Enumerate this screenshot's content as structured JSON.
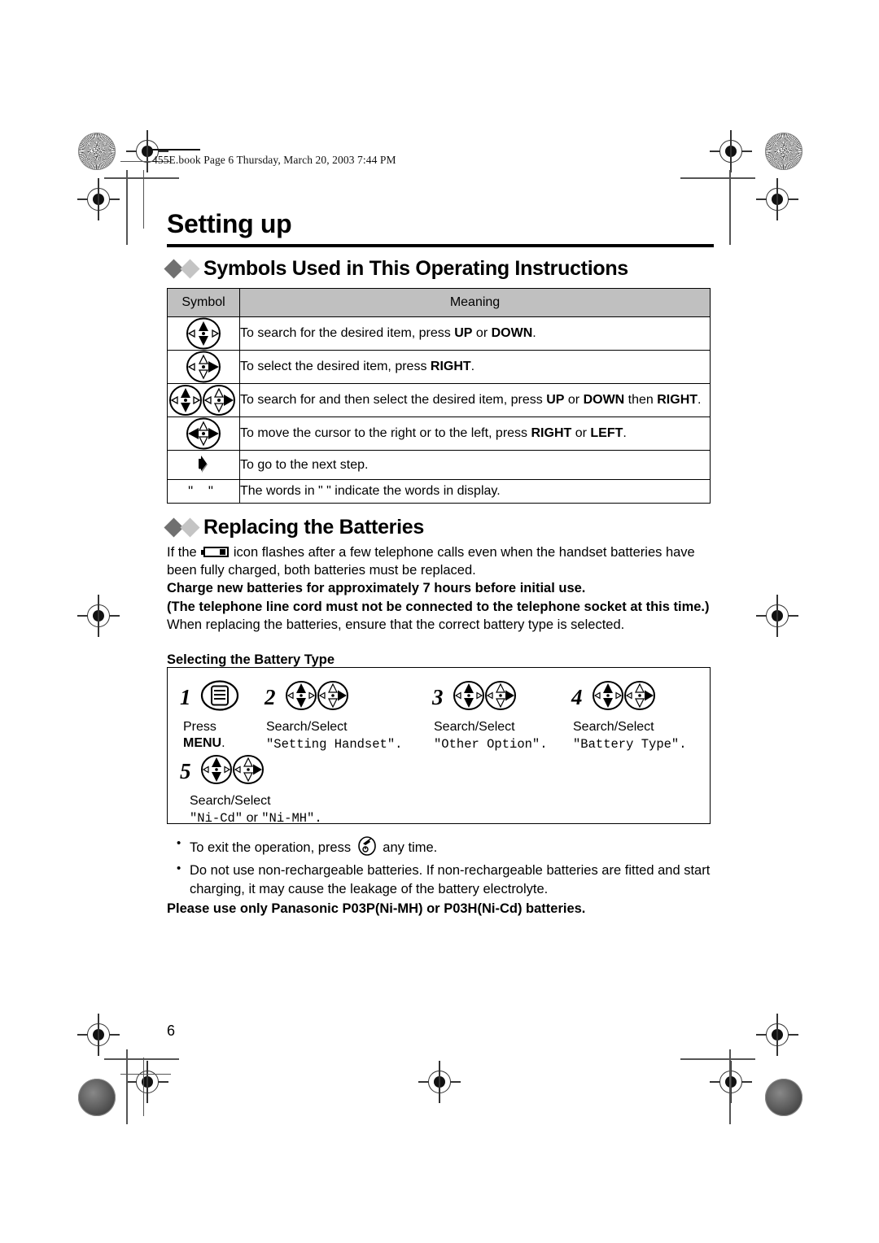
{
  "filestamp": "455E.book  Page 6  Thursday, March 20, 2003  7:44 PM",
  "chapter_title": "Setting up",
  "sections": {
    "symbols": {
      "title": "Symbols Used in This Operating Instructions"
    },
    "batteries": {
      "title": "Replacing the Batteries"
    }
  },
  "symbol_table": {
    "headers": [
      "Symbol",
      "Meaning"
    ],
    "rows": [
      {
        "icon": "nav-key-up-down-icon",
        "meaning_pre": "To search for the desired item, press ",
        "bold1": "UP",
        "mid": " or ",
        "bold2": "DOWN",
        "meaning_post": "."
      },
      {
        "icon": "nav-key-right-icon",
        "meaning_pre": "To select the desired item, press ",
        "bold1": "RIGHT",
        "mid": "",
        "bold2": "",
        "meaning_post": "."
      },
      {
        "icon": "nav-key-up-down-then-right-icon",
        "meaning_pre": "To search for and then select the desired item, press ",
        "bold1": "UP",
        "mid": " or ",
        "bold2": "DOWN",
        "meaning_post": " then ",
        "bold3": "RIGHT",
        "meaning_end": "."
      },
      {
        "icon": "nav-key-left-right-icon",
        "meaning_pre": "To move the cursor to the right or to the left, press ",
        "bold1": "RIGHT",
        "mid": " or ",
        "bold2": "LEFT",
        "meaning_post": "."
      },
      {
        "icon": "next-step-arrow-icon",
        "meaning_pre": "To go to the next step.",
        "bold1": "",
        "mid": "",
        "bold2": "",
        "meaning_post": ""
      },
      {
        "icon": "quotation-marks-icon",
        "icon_text": "\"  \"",
        "meaning_pre": "The words in \"  \" indicate the words in display.",
        "bold1": "",
        "mid": "",
        "bold2": "",
        "meaning_post": ""
      }
    ]
  },
  "battery_text": {
    "line1_a": "If the ",
    "line1_b": " icon flashes after a few telephone calls even when the handset batteries have been fully charged, both batteries must be replaced.",
    "bold1": "Charge new batteries for approximately 7 hours before initial use.",
    "bold2": "(The telephone line cord must not be connected to the telephone socket at this time.)",
    "line2": "When replacing the batteries, ensure that the correct battery type is selected.",
    "subhead": "Selecting the Battery Type"
  },
  "steps": [
    {
      "num": "1",
      "icons": [
        "menu-button-icon"
      ],
      "label_pre": "Press",
      "label_bold": "MENU",
      "label_post": ".",
      "display": ""
    },
    {
      "num": "2",
      "icons": [
        "nav-key-up-down-icon",
        "nav-key-right-icon"
      ],
      "label_pre": "Search/Select",
      "label_bold": "",
      "label_post": "",
      "display": "\"Setting Handset\"."
    },
    {
      "num": "3",
      "icons": [
        "nav-key-up-down-icon",
        "nav-key-right-icon"
      ],
      "label_pre": "Search/Select",
      "label_bold": "",
      "label_post": "",
      "display": "\"Other Option\"."
    },
    {
      "num": "4",
      "icons": [
        "nav-key-up-down-icon",
        "nav-key-right-icon"
      ],
      "label_pre": "Search/Select",
      "label_bold": "",
      "label_post": "",
      "display": "\"Battery Type\"."
    },
    {
      "num": "5",
      "icons": [
        "nav-key-up-down-icon",
        "nav-key-right-icon"
      ],
      "label_pre": "Search/Select",
      "label_bold": "",
      "label_post": "",
      "display": "\"Ni-Cd\"",
      "display_or": " or ",
      "display2": "\"Ni-MH\"."
    }
  ],
  "bullets": [
    {
      "pre": "To exit the operation, press ",
      "icon": "power-off-button-icon",
      "post": " any time."
    },
    {
      "pre": "Do not use non-rechargeable batteries. If non-rechargeable batteries are fitted and start charging, it may cause the leakage of the battery electrolyte.",
      "icon": "",
      "post": ""
    }
  ],
  "final_note": "Please use only Panasonic P03P(Ni-MH) or P03H(Ni-Cd) batteries.",
  "page_number": "6",
  "colors": {
    "table_header_bg": "#c0c0c0",
    "diamond_dark": "#707070",
    "diamond_light": "#c4c4c4",
    "rule": "#000000"
  }
}
